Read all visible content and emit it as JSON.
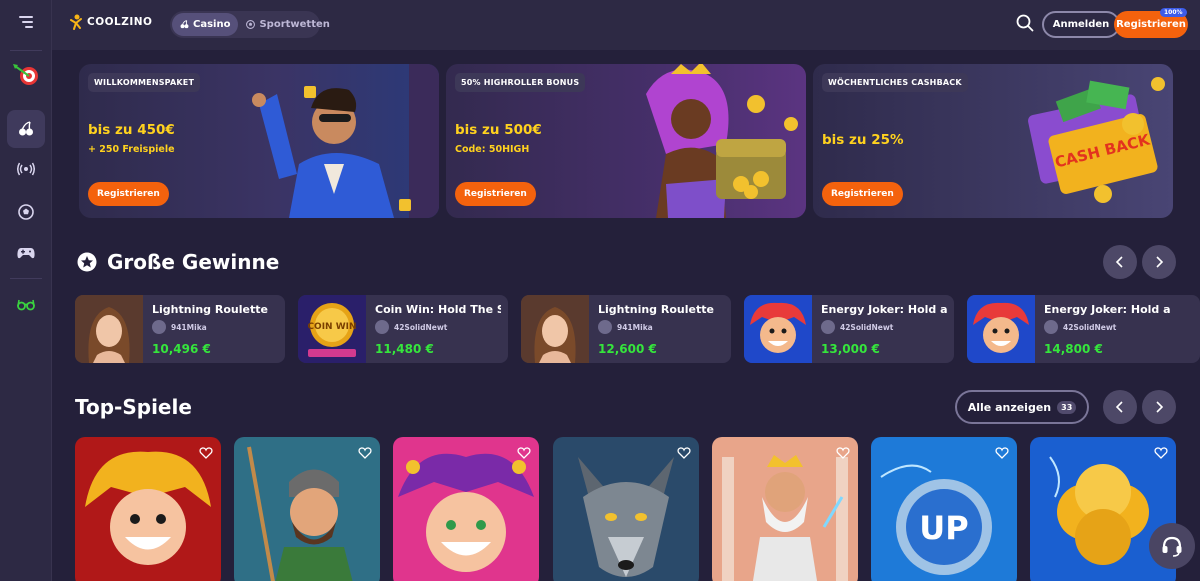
{
  "header": {
    "logo_text": "COOLZINO",
    "modes": [
      {
        "label": "Casino",
        "active": true
      },
      {
        "label": "Sportwetten",
        "active": false
      }
    ],
    "login_label": "Anmelden",
    "register_label": "Registrieren",
    "register_badge": "100%"
  },
  "sidebar": {
    "items": [
      {
        "icon": "menu-icon"
      },
      {
        "icon": "dart-target-icon"
      },
      {
        "icon": "cherries-icon",
        "active": true
      },
      {
        "icon": "live-broadcast-icon"
      },
      {
        "icon": "soccer-ball-icon"
      },
      {
        "icon": "gamepad-icon"
      },
      {
        "icon": "glasses-icon"
      }
    ]
  },
  "promos": [
    {
      "tag": "WILLKOMMENSPAKET",
      "big": "bis zu 450€",
      "small": "+ 250 Freispiele",
      "cta": "Registrieren"
    },
    {
      "tag": "50% HIGHROLLER BONUS",
      "big": "bis zu 500€",
      "small": "Code: 50HIGH",
      "cta": "Registrieren"
    },
    {
      "tag": "WÖCHENTLICHES CASHBACK",
      "big": "bis zu 25%",
      "small": "",
      "cta": "Registrieren"
    }
  ],
  "big_wins": {
    "title": "Große Gewinne",
    "items": [
      {
        "game": "Lightning Roulette",
        "user": "941Mika",
        "amount": "10,496 €"
      },
      {
        "game": "Coin Win: Hold The Spin",
        "user": "42SolidNewt",
        "amount": "11,480 €"
      },
      {
        "game": "Lightning Roulette",
        "user": "941Mika",
        "amount": "12,600 €"
      },
      {
        "game": "Energy Joker: Hold and Win",
        "user": "42SolidNewt",
        "amount": "13,000 €"
      },
      {
        "game": "Energy Joker: Hold and Win",
        "user": "42SolidNewt",
        "amount": "14,800 €"
      }
    ]
  },
  "top_games": {
    "title": "Top-Spiele",
    "show_all_label": "Alle anzeigen",
    "count": "33"
  },
  "art_text": {
    "cashback": "CASH BACK",
    "coin_win": "COIN WIN",
    "up": "UP"
  }
}
